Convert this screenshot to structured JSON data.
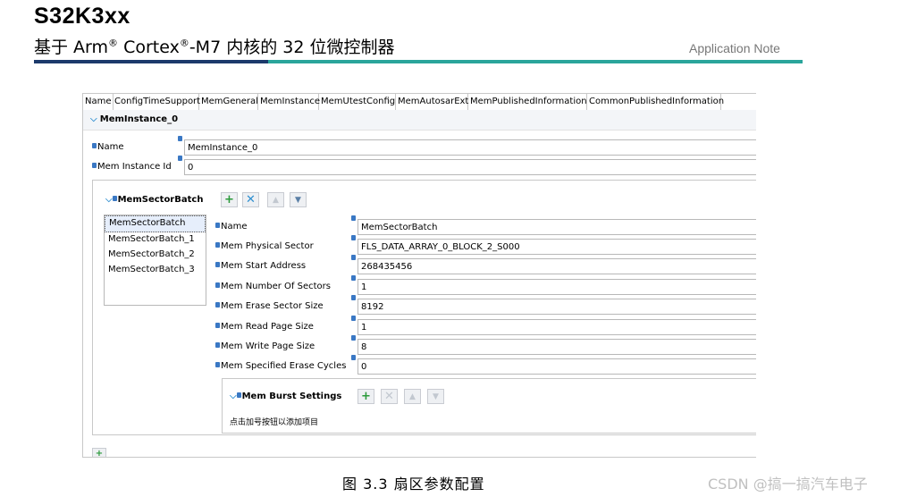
{
  "doc": {
    "title": "S32K3xx",
    "subtitle_pre": "基于 Arm",
    "subtitle_mid": " Cortex",
    "subtitle_post": "-M7 内核的 32 位微控制器",
    "reg": "®",
    "app_note": "Application Note",
    "caption": "图 3.3 扇区参数配置",
    "watermark": "CSDN @搞一搞汽车电子"
  },
  "tabs": [
    "Name",
    "ConfigTimeSupport",
    "MemGeneral",
    "MemInstance",
    "MemUtestConfig",
    "MemAutosarExt",
    "MemPublishedInformation",
    "CommonPublishedInformation"
  ],
  "active_tab": "MemInstance",
  "instance": {
    "header": "MemInstance_0",
    "name_label": "Name",
    "name_value": "MemInstance_0",
    "id_label": "Mem Instance Id",
    "id_value": "0"
  },
  "sector_batch": {
    "header": "MemSectorBatch",
    "list": [
      "MemSectorBatch",
      "MemSectorBatch_1",
      "MemSectorBatch_2",
      "MemSectorBatch_3"
    ],
    "fields": [
      {
        "label": "Name",
        "value": "MemSectorBatch"
      },
      {
        "label": "Mem Physical Sector",
        "value": "FLS_DATA_ARRAY_0_BLOCK_2_S000"
      },
      {
        "label": "Mem Start Address",
        "value": "268435456"
      },
      {
        "label": "Mem Number Of Sectors",
        "value": "1"
      },
      {
        "label": "Mem Erase Sector Size",
        "value": "8192"
      },
      {
        "label": "Mem Read Page Size",
        "value": "1"
      },
      {
        "label": "Mem Write Page Size",
        "value": "8"
      },
      {
        "label": "Mem Specified Erase Cycles",
        "value": "0"
      }
    ]
  },
  "burst": {
    "header": "Mem Burst Settings",
    "hint": "点击加号按钮以添加项目"
  },
  "icons": {
    "add": "+",
    "delete": "✕",
    "up": "▲",
    "down": "▼",
    "chevron": "❯"
  },
  "colors": {
    "navy": "#1c3a6b",
    "teal": "#2aa59b",
    "add": "#2a9a3a",
    "accent": "#2e8fd0"
  }
}
